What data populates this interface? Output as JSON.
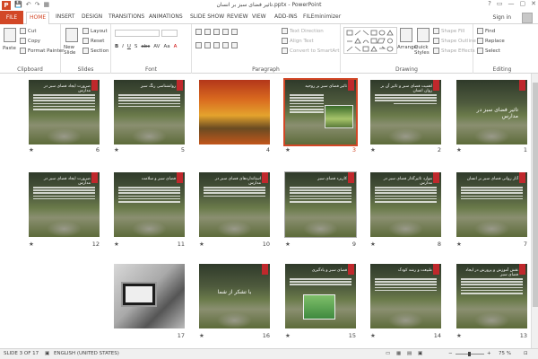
{
  "titlebar": {
    "logo": "P",
    "doc_title": "تاثیر فضای سبز بر انسان.pptx - PowerPoint",
    "qat": [
      "💾",
      "↶",
      "↷",
      "▦"
    ],
    "win_buttons": [
      "?",
      "▭",
      "—",
      "▢",
      "✕"
    ]
  },
  "tabs": [
    {
      "label": "FILE"
    },
    {
      "label": "HOME"
    },
    {
      "label": "INSERT"
    },
    {
      "label": "DESIGN"
    },
    {
      "label": "TRANSITIONS"
    },
    {
      "label": "ANIMATIONS"
    },
    {
      "label": "SLIDE SHOW"
    },
    {
      "label": "REVIEW"
    },
    {
      "label": "VIEW"
    },
    {
      "label": "ADD-INS"
    },
    {
      "label": "FILEminimizer"
    }
  ],
  "signin": "Sign in",
  "ribbon": {
    "clipboard": {
      "label": "Clipboard",
      "paste": "Paste",
      "cut": "Cut",
      "copy": "Copy",
      "format_painter": "Format Painter"
    },
    "slides": {
      "label": "Slides",
      "new_slide": "New Slide",
      "layout": "Layout",
      "reset": "Reset",
      "section": "Section"
    },
    "font": {
      "label": "Font",
      "buttons": [
        "B",
        "I",
        "U",
        "S",
        "abc",
        "AV",
        "Aa",
        "A"
      ]
    },
    "paragraph": {
      "label": "Paragraph",
      "text_direction": "Text Direction",
      "align_text": "Align Text",
      "convert_smartart": "Convert to SmartArt"
    },
    "drawing": {
      "label": "Drawing",
      "arrange": "Arrange",
      "quick_styles": "Quick Styles",
      "shape_fill": "Shape Fill",
      "shape_outline": "Shape Outline",
      "shape_effects": "Shape Effects"
    },
    "editing": {
      "label": "Editing",
      "find": "Find",
      "replace": "Replace",
      "select": "Select"
    }
  },
  "slides": [
    {
      "num": "1",
      "title": "تاثیر فضای سبز در مدارس"
    },
    {
      "num": "2",
      "title": "اهمیت فضای سبز و تاثیر آن بر روان انسان"
    },
    {
      "num": "3",
      "title": "تاثیر فضای سبز بر روحیه"
    },
    {
      "num": "4",
      "title": ""
    },
    {
      "num": "5",
      "title": "روانشناسی رنگ سبز"
    },
    {
      "num": "6",
      "title": "ضرورت ایجاد فضای سبز در مدارس"
    },
    {
      "num": "7",
      "title": "آثار روانی فضای سبز بر انسان"
    },
    {
      "num": "8",
      "title": "موارد تاثیرگذار فضای سبز در مدارس"
    },
    {
      "num": "9",
      "title": "کاربرد فضای سبز"
    },
    {
      "num": "10",
      "title": "استانداردهای فضای سبز در مدارس"
    },
    {
      "num": "11",
      "title": "فضای سبز و سلامت"
    },
    {
      "num": "12",
      "title": "ضرورت ایجاد فضای سبز در مدارس"
    },
    {
      "num": "13",
      "title": "نقش آموزش و پرورش در ایجاد فضای سبز"
    },
    {
      "num": "14",
      "title": "طبیعت و رشد کودک"
    },
    {
      "num": "15",
      "title": "فضای سبز و یادگیری"
    },
    {
      "num": "16",
      "title": "با تشکر از شما"
    },
    {
      "num": "17",
      "title": ""
    }
  ],
  "status": {
    "slide_count": "SLIDE 3 OF 17",
    "language": "ENGLISH (UNITED STATES)",
    "zoom": "75 %",
    "zoom_minus": "−",
    "zoom_plus": "+"
  },
  "colors": {
    "accent": "#d24726",
    "slide_red": "#c0282c"
  }
}
